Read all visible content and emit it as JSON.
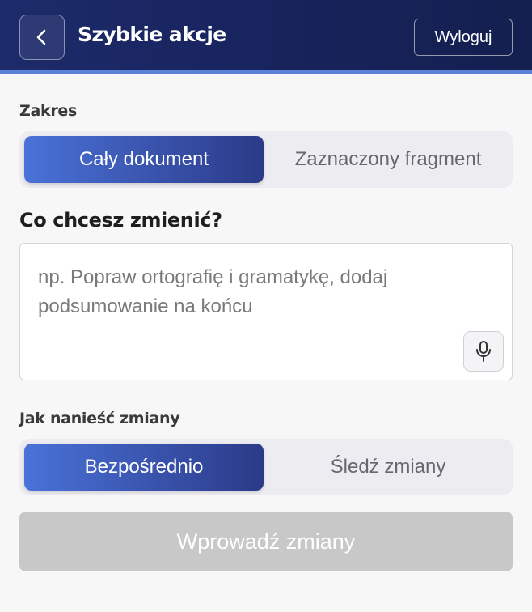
{
  "header": {
    "title": "Szybkie akcje",
    "back_icon": "chevron-left-icon",
    "logout_label": "Wyloguj"
  },
  "scope": {
    "label": "Zakres",
    "options": [
      "Cały dokument",
      "Zaznaczony fragment"
    ],
    "selected": "Cały dokument"
  },
  "prompt": {
    "question": "Co chcesz zmienić?",
    "value": "",
    "placeholder": "np. Popraw ortografię i gramatykę, dodaj podsumowanie na końcu",
    "mic_icon": "microphone-icon"
  },
  "apply_mode": {
    "label": "Jak nanieść zmiany",
    "options": [
      "Bezpośrednio",
      "Śledź zmiany"
    ],
    "selected": "Bezpośrednio"
  },
  "submit": {
    "label": "Wprowadź zmiany",
    "disabled": true
  },
  "colors": {
    "header_bg": "#1d2b6b",
    "accent_strip": "#5b82d6",
    "active_segment": "#3a55b0",
    "disabled_button": "#c8c8c8"
  }
}
